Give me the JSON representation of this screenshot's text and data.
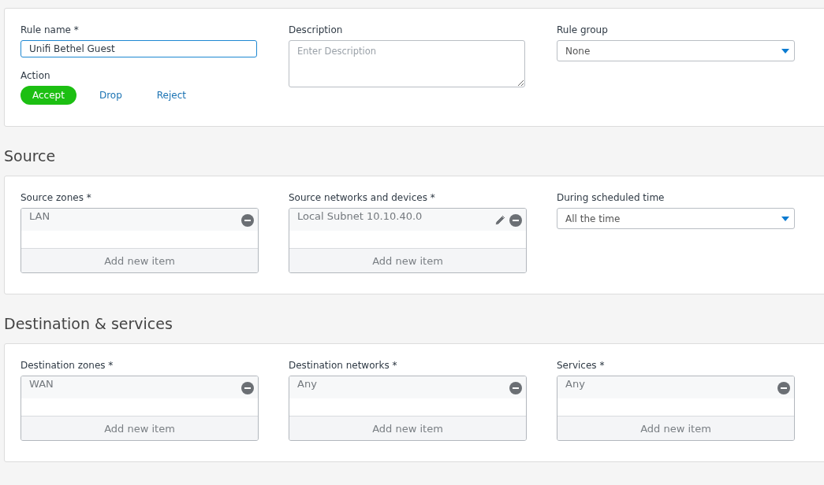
{
  "general": {
    "rule_name": {
      "label": "Rule name *",
      "value": "Unifi Bethel Guest"
    },
    "action": {
      "label": "Action",
      "options": [
        {
          "label": "Accept",
          "selected": true
        },
        {
          "label": "Drop",
          "selected": false
        },
        {
          "label": "Reject",
          "selected": false
        }
      ]
    },
    "description": {
      "label": "Description",
      "placeholder": "Enter Description"
    },
    "rule_group": {
      "label": "Rule group",
      "value": "None"
    }
  },
  "sections": [
    {
      "title": "Source",
      "fields": [
        {
          "kind": "list",
          "label": "Source zones *",
          "items": [
            {
              "text": "LAN",
              "editable": false
            }
          ],
          "add_label": "Add new item"
        },
        {
          "kind": "list",
          "label": "Source networks and devices *",
          "items": [
            {
              "text": "Local Subnet 10.10.40.0",
              "editable": true
            }
          ],
          "add_label": "Add new item"
        },
        {
          "kind": "select",
          "label": "During scheduled time",
          "value": "All the time"
        }
      ]
    },
    {
      "title": "Destination & services",
      "fields": [
        {
          "kind": "list",
          "label": "Destination zones *",
          "items": [
            {
              "text": "WAN",
              "editable": false
            }
          ],
          "add_label": "Add new item"
        },
        {
          "kind": "list",
          "label": "Destination networks *",
          "items": [
            {
              "text": "Any",
              "editable": false
            }
          ],
          "add_label": "Add new item"
        },
        {
          "kind": "list",
          "label": "Services *",
          "items": [
            {
              "text": "Any",
              "editable": false
            }
          ],
          "add_label": "Add new item"
        }
      ]
    }
  ]
}
